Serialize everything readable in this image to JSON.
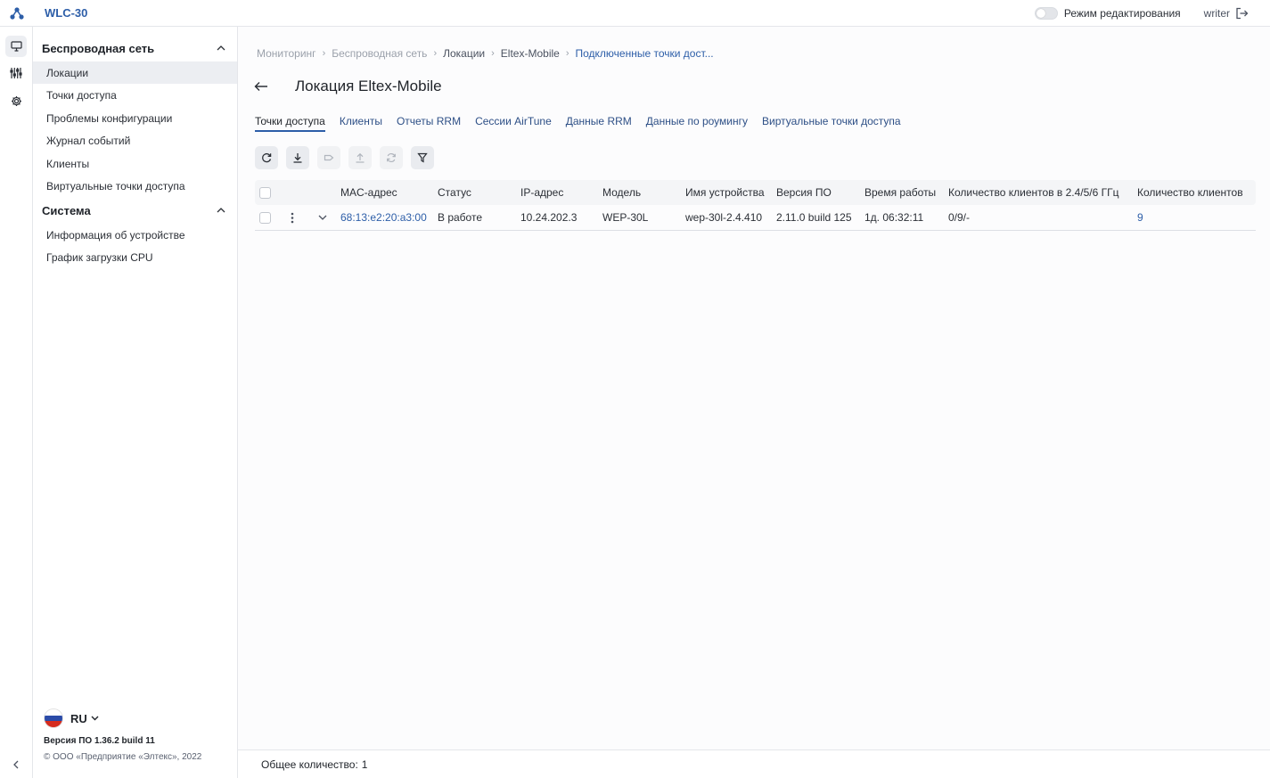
{
  "app": {
    "title": "WLC-30"
  },
  "topbar": {
    "edit_mode_label": "Режим редактирования",
    "username": "writer"
  },
  "sidebar": {
    "groups": [
      {
        "title": "Беспроводная сеть",
        "items": [
          {
            "label": "Локации",
            "active": true
          },
          {
            "label": "Точки доступа"
          },
          {
            "label": "Проблемы конфигурации"
          },
          {
            "label": "Журнал событий"
          },
          {
            "label": "Клиенты"
          },
          {
            "label": "Виртуальные точки доступа"
          }
        ]
      },
      {
        "title": "Система",
        "items": [
          {
            "label": "Информация об устройстве"
          },
          {
            "label": "График загрузки CPU"
          }
        ]
      }
    ],
    "language": "RU",
    "version": "Версия ПО 1.36.2 build 11",
    "copyright": "© ООО «Предприятие «Элтекс», 2022"
  },
  "breadcrumb": [
    "Мониторинг",
    "Беспроводная сеть",
    "Локации",
    "Eltex-Mobile",
    "Подключенные точки дост..."
  ],
  "page": {
    "title": "Локация Eltex-Mobile"
  },
  "tabs": [
    "Точки доступа",
    "Клиенты",
    "Отчеты RRM",
    "Сессии AirTune",
    "Данные RRM",
    "Данные по роумингу",
    "Виртуальные точки доступа"
  ],
  "table": {
    "columns": [
      "MAC-адрес",
      "Статус",
      "IP-адрес",
      "Модель",
      "Имя устройства",
      "Версия ПО",
      "Время работы",
      "Количество клиентов в 2.4/5/6 ГГц",
      "Количество клиентов"
    ],
    "rows": [
      [
        "68:13:e2:20:a3:00",
        "В работе",
        "10.24.202.3",
        "WEP-30L",
        "wep-30l-2.4.410",
        "2.11.0 build 125",
        "1д. 06:32:11",
        "0/9/-",
        "9"
      ]
    ]
  },
  "footer": {
    "total_label": "Общее количество:",
    "total_value": "1"
  },
  "colors": {
    "accent": "#2d5ea8",
    "active_bg": "#eceef2"
  }
}
